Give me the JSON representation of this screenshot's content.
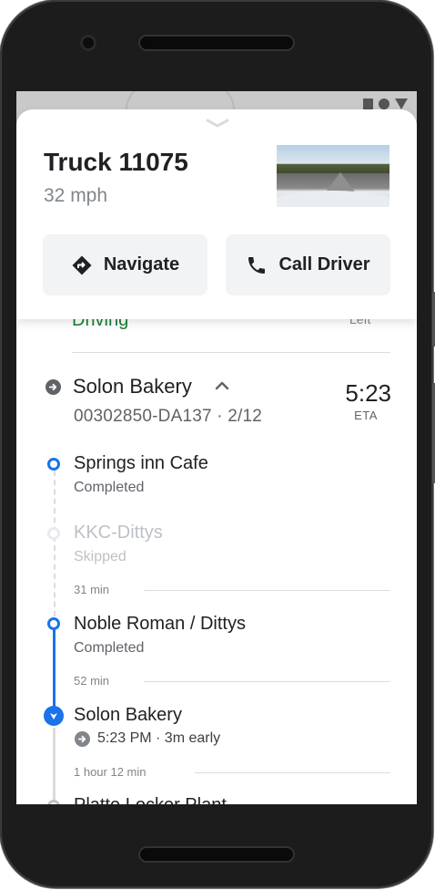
{
  "vehicle": {
    "name": "Truck 11075",
    "speed": "32 mph"
  },
  "actions": {
    "navigate_label": "Navigate",
    "call_label": "Call Driver"
  },
  "driver_status": {
    "state": "Driving",
    "time_label": "Left"
  },
  "route": {
    "name": "Solon Bakery",
    "id_line": "00302850-DA137 · 2/12",
    "eta_time": "5:23",
    "eta_label": "ETA"
  },
  "stops": [
    {
      "name": "Springs inn Cafe",
      "status": "Completed"
    },
    {
      "name": "KKC-Dittys",
      "status": "Skipped"
    },
    {
      "name": "Noble Roman / Dittys",
      "status": "Completed"
    },
    {
      "name": "Solon Bakery",
      "arrival": "5:23 PM · 3m early"
    },
    {
      "name": "Platte Locker Plant"
    }
  ],
  "durations": [
    "31 min",
    "52 min",
    "1 hour 12 min"
  ],
  "colors": {
    "accent_blue": "#1a73e8",
    "driving_green": "#188038",
    "button_bg": "#f1f3f4"
  },
  "icons": {
    "navigate": "directions-diamond-icon",
    "call": "phone-icon",
    "route": "arrow-circle-icon",
    "collapse": "chevron-up-icon"
  }
}
